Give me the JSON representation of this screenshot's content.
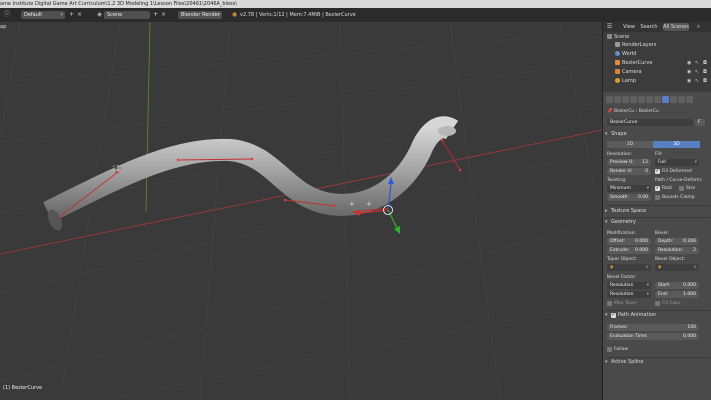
{
  "titlebar": {
    "text": "ame Institute Digital Game Art  Curriculum\\1.2 3D Modeling 1\\Lesson Files\\20461\\2046A_bless\\"
  },
  "topbar": {
    "layout_select": "Default",
    "scene_select": "Scene",
    "render_engine": "Blender Render",
    "status": "v2.78 | Verts:1/12 | Mem:7.4MiB | BezierCurve"
  },
  "viewport": {
    "corner_label": "ap",
    "object_label": "(1) BezierCurve"
  },
  "outliner": {
    "tabs": [
      "View",
      "Search",
      "All Scenes"
    ],
    "items": [
      "Scene",
      "RenderLayers",
      "World",
      "BezierCurve",
      "Camera",
      "Lamp"
    ]
  },
  "properties": {
    "breadcrumb": [
      "BezierCu",
      "BezierCu"
    ],
    "datablock_name": "BezierCurve",
    "datablock_users": "F",
    "shape": {
      "title": "Shape",
      "mode_2d": "2D",
      "mode_3d": "3D",
      "resolution_label": "Resolution:",
      "fill_label": "Fill:",
      "preview_u": {
        "label": "Preview U:",
        "value": "12"
      },
      "render_u": {
        "label": "Render U:",
        "value": "0"
      },
      "fill_value": "Full",
      "fill_deformed": "Fill Deformed",
      "twisting_label": "Twisting:",
      "path_curve_label": "Path / Curve-Deform:",
      "twisting_value": "Minimum",
      "smooth": {
        "label": "Smooth:",
        "value": "0.00"
      },
      "radius": "Radi",
      "stretch": "Stre",
      "bounds_clamp": "Bounds Clamp"
    },
    "texture_space": {
      "title": "Texture Space"
    },
    "geometry": {
      "title": "Geometry",
      "modification_label": "Modification:",
      "bevel_label": "Bevel:",
      "offset": {
        "label": "Offset:",
        "value": "0.000"
      },
      "depth": {
        "label": "Depth:",
        "value": "0.206"
      },
      "extrude": {
        "label": "Extrude:",
        "value": "0.000"
      },
      "resolution": {
        "label": "Resolution:",
        "value": "2"
      },
      "taper_object": "Taper Object:",
      "bevel_object": "Bevel Object:",
      "bevel_factor_label": "Bevel Factor:",
      "factor_mode_1": "Resolution",
      "factor_mode_2": "Resolution",
      "start": {
        "label": "Start:",
        "value": "0.000"
      },
      "end": {
        "label": "End:",
        "value": "1.000"
      },
      "map_taper": "Map Taper",
      "fill_caps": "Fill Caps"
    },
    "path_animation": {
      "title": "Path Animation",
      "frames": {
        "label": "Frames:",
        "value": "100"
      },
      "evaluation_time": {
        "label": "Evaluation Time:",
        "value": "0.000"
      },
      "follow": "Follow"
    },
    "active_spline": {
      "title": "Active Spline"
    }
  },
  "colors": {
    "accent": "#5680c2",
    "viewport_bg": "#3a3a3a",
    "grid_red": "#a83a3a",
    "grid_green": "#5a8a2a"
  }
}
